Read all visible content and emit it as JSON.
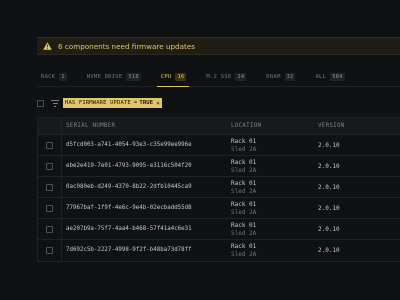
{
  "alert": {
    "icon": "warning-icon",
    "text": "6 components need firmware updates",
    "color": "#e2c76a"
  },
  "tabs": [
    {
      "label": "RACK",
      "count": "1",
      "active": false
    },
    {
      "label": "NVME DRIVE",
      "count": "518",
      "active": false
    },
    {
      "label": "CPU",
      "count": "16",
      "active": true
    },
    {
      "label": "M.2 SSD",
      "count": "14",
      "active": false
    },
    {
      "label": "DRAM",
      "count": "32",
      "active": false
    },
    {
      "label": "ALL",
      "count": "584",
      "active": false
    }
  ],
  "filter": {
    "icon": "filter-icon",
    "key": "HAS FIRMWARE UPDATE",
    "operator": "=",
    "value": "TRUE",
    "remove": "×"
  },
  "table": {
    "headers": {
      "serial": "SERIAL NUMBER",
      "location": "LOCATION",
      "version": "VERSION"
    },
    "rows": [
      {
        "serial": "d5fcd003-a741-4054-93e3-c35e99ee996e",
        "rack": "Rack 01",
        "sled": "Sled 2A",
        "version": "2.0.10"
      },
      {
        "serial": "ebe2e419-7e01-4793-9095-e3116c504f20",
        "rack": "Rack 01",
        "sled": "Sled 2A",
        "version": "2.0.10"
      },
      {
        "serial": "0ac080eb-d249-4370-8b22-2dfb10445ca9",
        "rack": "Rack 01",
        "sled": "Sled 2A",
        "version": "2.0.10"
      },
      {
        "serial": "77967baf-1f9f-4e6c-9e4b-02ecbadd55d8",
        "rack": "Rack 01",
        "sled": "Sled 2A",
        "version": "2.0.10"
      },
      {
        "serial": "ae207b9a-75f7-4aa4-b468-57f41a4c6e31",
        "rack": "Rack 01",
        "sled": "Sled 2A",
        "version": "2.0.10"
      },
      {
        "serial": "7d692c5b-2227-4998-9f2f-b48ba73d78ff",
        "rack": "Rack 01",
        "sled": "Sled 2A",
        "version": "2.0.10"
      }
    ]
  }
}
